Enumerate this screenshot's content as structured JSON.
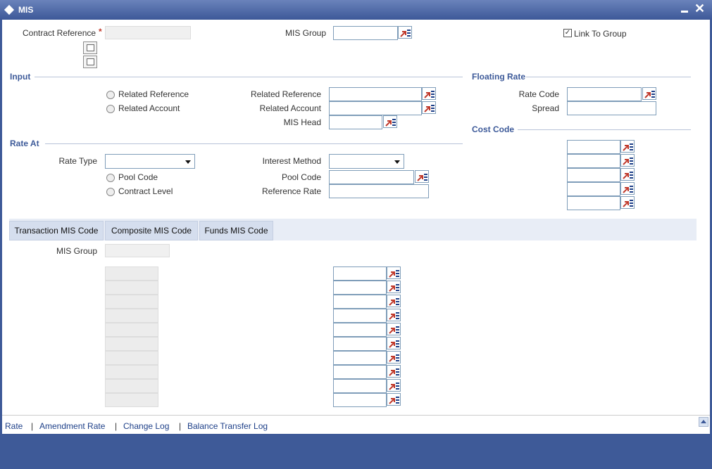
{
  "window": {
    "title": "MIS"
  },
  "header": {
    "contract_reference_label": "Contract Reference",
    "required_mark": "*",
    "mis_group_label": "MIS Group",
    "link_to_group_label": "Link To Group",
    "link_to_group_checked": true
  },
  "input_section": {
    "title": "Input",
    "radio_related_reference": "Related Reference",
    "radio_related_account": "Related Account",
    "related_reference_label": "Related Reference",
    "related_account_label": "Related Account",
    "mis_head_label": "MIS Head"
  },
  "floating_rate": {
    "title": "Floating Rate",
    "rate_code_label": "Rate Code",
    "spread_label": "Spread"
  },
  "cost_code": {
    "title": "Cost Code"
  },
  "rate_at": {
    "title": "Rate At",
    "rate_type_label": "Rate Type",
    "interest_method_label": "Interest Method",
    "radio_pool_code": "Pool Code",
    "radio_contract_level": "Contract Level",
    "pool_code_label": "Pool Code",
    "reference_rate_label": "Reference Rate"
  },
  "tabs": [
    {
      "label": "Transaction MIS Code"
    },
    {
      "label": "Composite MIS Code"
    },
    {
      "label": "Funds MIS Code"
    }
  ],
  "tab_content": {
    "mis_group_label": "MIS Group"
  },
  "footer": {
    "links": [
      "Rate",
      "Amendment Rate",
      "Change Log",
      "Balance Transfer Log"
    ],
    "separator": "|"
  },
  "colors": {
    "accent": "#3e5a98",
    "section_title": "#3d5a99",
    "link": "#1d3f88"
  }
}
